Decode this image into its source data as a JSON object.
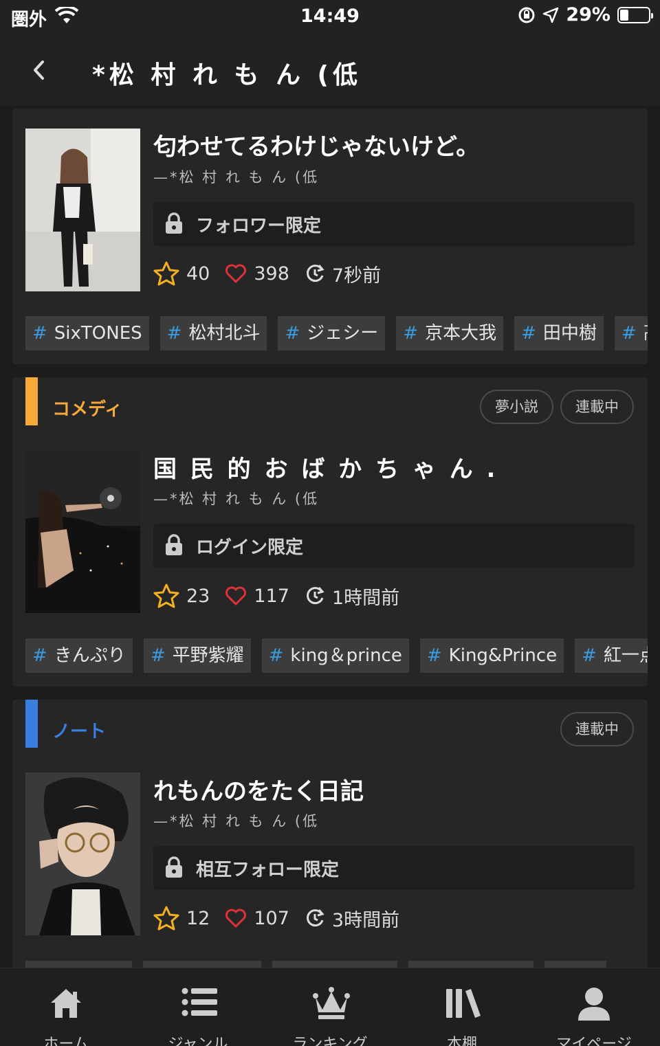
{
  "status": {
    "carrier": "圏外",
    "time": "14:49",
    "battery": "29%",
    "battery_level": 0.29
  },
  "header": {
    "title": "*松 村 れ も ん (低"
  },
  "works": [
    {
      "title": "匂わせてるわけじゃないけど。",
      "author": "—*松 村 れ も ん (低",
      "restriction": "フォロワー限定",
      "stars": "40",
      "likes": "398",
      "updated": "7秒前",
      "tags": [
        "SixTONES",
        "松村北斗",
        "ジェシー",
        "京本大我",
        "田中樹",
        "髙"
      ]
    },
    {
      "genre": "コメディ",
      "genre_color": "#f7a93a",
      "pills": [
        "夢小説",
        "連載中"
      ],
      "title": "国 民 的 お ば か ち ゃ ん .",
      "author": "—*松 村 れ も ん (低",
      "restriction": "ログイン限定",
      "stars": "23",
      "likes": "117",
      "updated": "1時間前",
      "tags": [
        "きんぷり",
        "平野紫耀",
        "king＆prince",
        "King&Prince",
        "紅一点"
      ]
    },
    {
      "genre": "ノート",
      "genre_color": "#3a7fe0",
      "pills": [
        "連載中"
      ],
      "title": "れもんのをたく日記",
      "author": "—*松 村 れ も ん (低",
      "restriction": "相互フォロー限定",
      "stars": "12",
      "likes": "107",
      "updated": "3時間前"
    }
  ],
  "tabbar": {
    "home": "ホーム",
    "genre": "ジャンル",
    "ranking": "ランキング",
    "shelf": "本棚",
    "mypage": "マイページ"
  }
}
